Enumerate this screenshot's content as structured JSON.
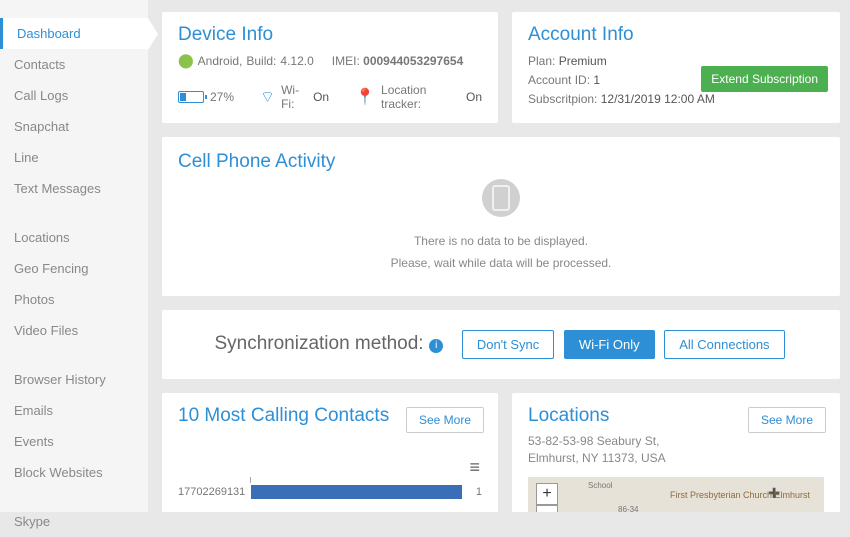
{
  "sidebar": {
    "groups": [
      [
        "Dashboard",
        "Contacts",
        "Call Logs",
        "Snapchat",
        "Line",
        "Text Messages"
      ],
      [
        "Locations",
        "Geo Fencing",
        "Photos",
        "Video Files"
      ],
      [
        "Browser History",
        "Emails",
        "Events",
        "Block Websites"
      ],
      [
        "Skype"
      ]
    ],
    "active": "Dashboard"
  },
  "device": {
    "title": "Device Info",
    "os_label": "Android,",
    "build_label": "Build:",
    "build_value": "4.12.0",
    "imei_label": "IMEI:",
    "imei_value": "000944053297654",
    "battery": "27%",
    "wifi_label": "Wi-Fi:",
    "wifi_value": "On",
    "loc_label": "Location tracker:",
    "loc_value": "On"
  },
  "account": {
    "title": "Account Info",
    "plan_label": "Plan:",
    "plan_value": "Premium",
    "id_label": "Account ID:",
    "id_value": "1",
    "sub_label": "Subscritpion:",
    "sub_value": "12/31/2019 12:00 AM",
    "extend": "Extend Subscription"
  },
  "activity": {
    "title": "Cell Phone Activity",
    "line1": "There is no data to be displayed.",
    "line2": "Please, wait while data will be processed."
  },
  "sync": {
    "label": "Synchronization method:",
    "options": [
      "Don't Sync",
      "Wi-Fi Only",
      "All Connections"
    ],
    "active": "Wi-Fi Only"
  },
  "calling": {
    "title": "10 Most Calling Contacts",
    "see_more": "See More",
    "first_number": "17702269131"
  },
  "locations": {
    "title": "Locations",
    "addr1": "53-82-53-98 Seabury St,",
    "addr2": "Elmhurst, NY 11373, USA",
    "see_more": "See More",
    "zoom_in": "+",
    "zoom_out": "−",
    "church": "First Presbyterian Church Elmhurst"
  },
  "chart_data": {
    "type": "bar",
    "orientation": "horizontal",
    "title": "10 Most Calling Contacts",
    "categories": [
      "17702269131"
    ],
    "values": [
      1
    ],
    "xlim": [
      0,
      1
    ],
    "note": "Only the first bar/row is visible in the cropped screenshot"
  }
}
